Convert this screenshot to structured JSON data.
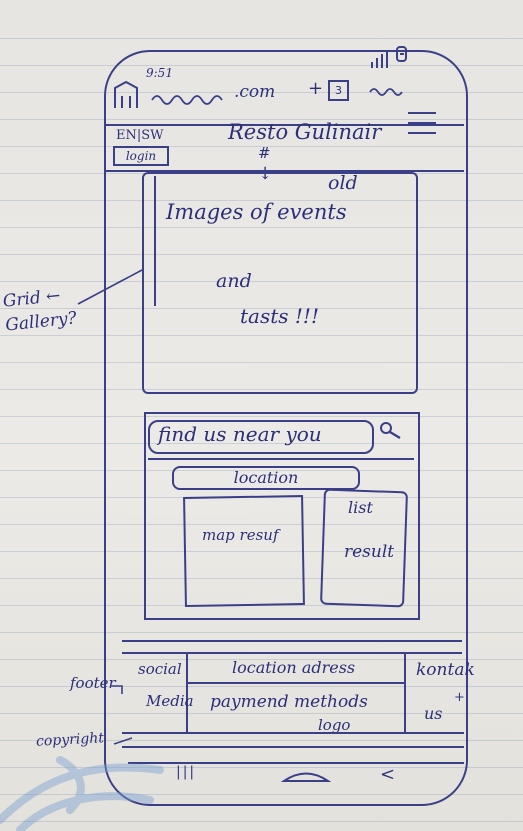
{
  "status_bar": {
    "time": "9:51",
    "signal_icon": "signal-bars-icon",
    "battery_icon": "battery-icon"
  },
  "browser_bar": {
    "home_icon": "home-icon",
    "url": ".com",
    "add_tab": "+",
    "tab_count": "3",
    "menu_icon": "ellipsis-icon"
  },
  "header": {
    "lang": "EN|SW",
    "login": "login",
    "title": "Resto Gulinair",
    "menu_icon": "hamburger-icon",
    "hash": "#",
    "arrow": "↓"
  },
  "gallery": {
    "line1": "old",
    "line2": "Images   of events",
    "line3": "and",
    "line4": "tasts !!!"
  },
  "find_us": {
    "heading": "find us near you",
    "search_icon": "search-icon",
    "location_field": "location",
    "map_result": "map resuf",
    "list_result_1": "list",
    "list_result_2": "result"
  },
  "footer": {
    "social": "social",
    "media": "Media",
    "location_adress": "location adress",
    "payment_methods": "paymend methods",
    "logo": "logo",
    "kontak": "kontak",
    "us": "us",
    "plus": "+"
  },
  "nav_bar": {
    "recents": "|||",
    "home": "home-pill-icon",
    "back": "<"
  },
  "annotations": {
    "grid_gallery": "Grid ←\nGallery?",
    "footer": "footer",
    "copyright": "copyright"
  }
}
